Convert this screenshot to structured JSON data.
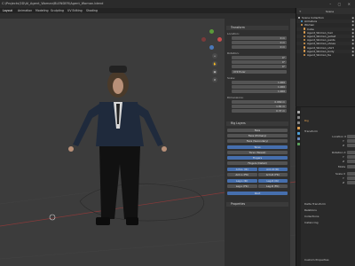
{
  "window": {
    "title": "C:\\Projects\\3D\\AI_Agent_Woman\\BLENDER\\Agent_Woman.blend",
    "buttons": [
      "–",
      "▢",
      "✕"
    ]
  },
  "menubar": {
    "items": [
      "Layout",
      "Animation",
      "Modeling",
      "Sculpting",
      "UV Editing",
      "Shading"
    ]
  },
  "outliner": {
    "search_placeholder": "",
    "view_layer": "Scene",
    "rows": [
      {
        "label": "Scene Collection",
        "color": "#cfcfcf"
      },
      {
        "label": "Armature",
        "color": "#4da0d8"
      },
      {
        "label": "Woman",
        "color": "#e0a050"
      },
      {
        "label": "Cube",
        "color": "#e0a050"
      },
      {
        "label": "Agent_Woman_hair",
        "color": "#e0a050"
      },
      {
        "label": "Agent_Woman_jacket",
        "color": "#e0a050"
      },
      {
        "label": "Agent_Woman_pants",
        "color": "#e0a050"
      },
      {
        "label": "Agent_Woman_shoes",
        "color": "#e0a050"
      },
      {
        "label": "Agent_Woman_shirt",
        "color": "#e0a050"
      },
      {
        "label": "Agent_Woman_body",
        "color": "#e0a050"
      },
      {
        "label": "Agent_Woman_tie",
        "color": "#e0a050"
      }
    ]
  },
  "properties": {
    "object_name": "Rig",
    "section": "Transform",
    "location": [
      "Location X",
      "Y",
      "Z"
    ],
    "rotation": [
      "Rotation X",
      "Y",
      "Z"
    ],
    "mode": "Mode",
    "scale": [
      "Scale X",
      "Y",
      "Z"
    ],
    "delta": "Delta Transform",
    "relations": "Relations",
    "collections": "Collections",
    "instancing": "Instancing",
    "custom_props": "Custom Properties"
  },
  "npanel": {
    "transform_header": "Transform",
    "location_label": "Location:",
    "location": [
      "0 m",
      "0 m",
      "0 m"
    ],
    "rotation_label": "Rotation:",
    "rotation": [
      "0°",
      "0°",
      "0°"
    ],
    "rotation_mode": "XYZ Euler",
    "scale_label": "Scale:",
    "scale": [
      "1.000",
      "1.000",
      "1.000"
    ],
    "dimensions_label": "Dimensions:",
    "dimensions": [
      "0.969 m",
      "1.81 m",
      "0.37 m"
    ],
    "rig_header": "Rig Layers",
    "buttons": [
      "Face",
      "Face (Primary)",
      "Face (Secondary)",
      "Torso",
      "Torso (Tweak)",
      "Fingers",
      "Fingers (Detail)",
      "Arm.L (IK)",
      "Arm.R (IK)",
      "Arm.L (FK)",
      "Arm.R (FK)",
      "Leg.L (IK)",
      "Leg.R (IK)",
      "Leg.L (FK)",
      "Leg.R (FK)",
      "Root"
    ],
    "properties_header": "Properties"
  }
}
